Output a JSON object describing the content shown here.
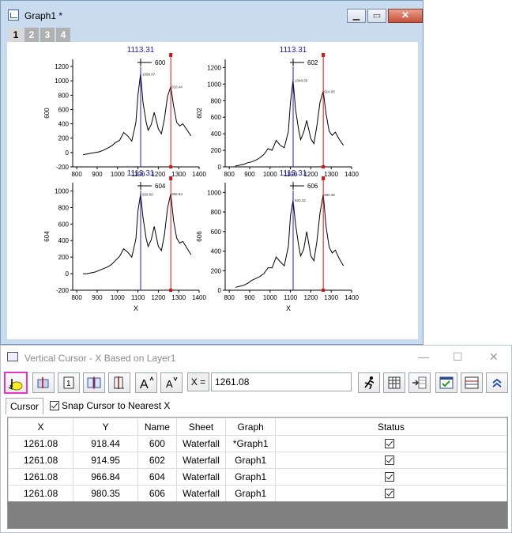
{
  "graph_window": {
    "title": "Graph1 *",
    "layer_tabs": [
      "1",
      "2",
      "3",
      "4"
    ],
    "active_layer": "1"
  },
  "chart_data": [
    {
      "type": "line",
      "layer": "600",
      "legend": "600",
      "ylabel": "600",
      "xlabel": "",
      "xlim": [
        780,
        1400
      ],
      "ylim": [
        -200,
        1300
      ],
      "xticks": [
        "800",
        "900",
        "1000",
        "1100",
        "1200",
        "1300",
        "1400"
      ],
      "yticks": [
        "-200",
        "0",
        "200",
        "400",
        "600",
        "800",
        "1000",
        "1200"
      ],
      "cursor_value": "1113.31",
      "blue_cursor_x": 1113.31,
      "red_cursor_x": 1261.08,
      "label_left": "1098.07",
      "label_right": "918.44",
      "peak_left_y": 1098.07,
      "peak_right_y": 918.44,
      "x": [
        830,
        850,
        870,
        890,
        910,
        930,
        950,
        970,
        990,
        1010,
        1030,
        1050,
        1070,
        1090,
        1100,
        1113,
        1125,
        1140,
        1150,
        1165,
        1180,
        1200,
        1215,
        1230,
        1245,
        1261,
        1275,
        1290,
        1305,
        1320,
        1340,
        1360
      ],
      "y": [
        -30,
        -20,
        -10,
        0,
        10,
        30,
        60,
        90,
        140,
        170,
        280,
        230,
        160,
        420,
        800,
        1098,
        700,
        430,
        310,
        390,
        560,
        330,
        260,
        470,
        780,
        918,
        650,
        420,
        370,
        400,
        320,
        230
      ]
    },
    {
      "type": "line",
      "layer": "602",
      "legend": "602",
      "ylabel": "602",
      "xlabel": "",
      "xlim": [
        780,
        1400
      ],
      "ylim": [
        0,
        1300
      ],
      "xticks": [
        "800",
        "900",
        "1000",
        "1100",
        "1200",
        "1300",
        "1400"
      ],
      "yticks": [
        "0",
        "200",
        "400",
        "600",
        "800",
        "1000",
        "1200"
      ],
      "cursor_value": "1113.31",
      "blue_cursor_x": 1113.31,
      "red_cursor_x": 1261.08,
      "label_left": "1048.55",
      "label_right": "914.95",
      "peak_left_y": 1048.55,
      "peak_right_y": 914.95,
      "x": [
        830,
        850,
        870,
        890,
        910,
        930,
        950,
        970,
        990,
        1010,
        1030,
        1050,
        1070,
        1090,
        1100,
        1113,
        1125,
        1140,
        1150,
        1165,
        1180,
        1200,
        1215,
        1230,
        1245,
        1261,
        1275,
        1290,
        1305,
        1320,
        1340,
        1360
      ],
      "y": [
        10,
        20,
        30,
        50,
        60,
        80,
        110,
        150,
        220,
        200,
        320,
        260,
        230,
        430,
        780,
        1048,
        700,
        450,
        330,
        420,
        560,
        340,
        280,
        500,
        780,
        915,
        640,
        430,
        380,
        420,
        330,
        260
      ]
    },
    {
      "type": "line",
      "layer": "604",
      "legend": "604",
      "ylabel": "604",
      "xlabel": "X",
      "xlim": [
        780,
        1400
      ],
      "ylim": [
        -200,
        1100
      ],
      "xticks": [
        "800",
        "900",
        "1000",
        "1100",
        "1200",
        "1300",
        "1400"
      ],
      "yticks": [
        "-200",
        "0",
        "200",
        "400",
        "600",
        "800",
        "1000"
      ],
      "cursor_value": "1113.31",
      "blue_cursor_x": 1113.31,
      "red_cursor_x": 1261.08,
      "label_left": "959.56",
      "label_right": "966.84",
      "peak_left_y": 959.56,
      "peak_right_y": 966.84,
      "x": [
        830,
        850,
        870,
        890,
        910,
        930,
        950,
        970,
        990,
        1010,
        1030,
        1050,
        1070,
        1090,
        1100,
        1113,
        1125,
        1140,
        1150,
        1165,
        1180,
        1200,
        1215,
        1230,
        1245,
        1261,
        1275,
        1290,
        1305,
        1320,
        1340,
        1360
      ],
      "y": [
        0,
        0,
        10,
        20,
        40,
        60,
        80,
        110,
        160,
        210,
        300,
        260,
        200,
        420,
        760,
        960,
        680,
        430,
        330,
        410,
        570,
        330,
        280,
        470,
        790,
        967,
        640,
        430,
        370,
        390,
        310,
        230
      ]
    },
    {
      "type": "line",
      "layer": "606",
      "legend": "606",
      "ylabel": "606",
      "xlabel": "X",
      "xlim": [
        780,
        1400
      ],
      "ylim": [
        0,
        1100
      ],
      "xticks": [
        "800",
        "900",
        "1000",
        "1100",
        "1200",
        "1300",
        "1400"
      ],
      "yticks": [
        "0",
        "200",
        "400",
        "600",
        "800",
        "1000"
      ],
      "cursor_value": "1113.31",
      "blue_cursor_x": 1113.31,
      "red_cursor_x": 1261.08,
      "label_left": "920.32",
      "label_right": "980.35",
      "peak_left_y": 920.32,
      "peak_right_y": 980.35,
      "x": [
        830,
        850,
        870,
        890,
        910,
        930,
        950,
        970,
        990,
        1010,
        1030,
        1050,
        1070,
        1090,
        1100,
        1113,
        1125,
        1140,
        1150,
        1165,
        1180,
        1200,
        1215,
        1230,
        1245,
        1261,
        1275,
        1290,
        1305,
        1320,
        1340,
        1360
      ],
      "y": [
        30,
        40,
        50,
        70,
        100,
        120,
        140,
        170,
        230,
        230,
        340,
        290,
        250,
        450,
        760,
        920,
        680,
        460,
        350,
        420,
        600,
        350,
        300,
        500,
        790,
        980,
        650,
        440,
        380,
        410,
        320,
        250
      ]
    }
  ],
  "cursor_window": {
    "title": "Vertical Cursor - X Based on Layer1",
    "x_label": "X =",
    "x_value": "1261.08",
    "tab_label": "Cursor",
    "snap_label": "Snap Cursor to Nearest X",
    "snap_checked": true,
    "toolbar_icons": [
      "select-cursor-icon",
      "add-cursor-icon",
      "one-cursor-icon",
      "two-cursor-icon",
      "edit-labels-icon",
      "increase-font-icon",
      "decrease-font-icon",
      "run-icon",
      "table-icon",
      "export-icon",
      "report-icon",
      "settings-icon",
      "collapse-icon"
    ],
    "columns": [
      "X",
      "Y",
      "Name",
      "Sheet",
      "Graph",
      "Status"
    ],
    "rows": [
      {
        "x": "1261.08",
        "y": "918.44",
        "name": "600",
        "sheet": "Waterfall",
        "graph": "*Graph1",
        "status": true
      },
      {
        "x": "1261.08",
        "y": "914.95",
        "name": "602",
        "sheet": "Waterfall",
        "graph": "Graph1",
        "status": true
      },
      {
        "x": "1261.08",
        "y": "966.84",
        "name": "604",
        "sheet": "Waterfall",
        "graph": "Graph1",
        "status": true
      },
      {
        "x": "1261.08",
        "y": "980.35",
        "name": "606",
        "sheet": "Waterfall",
        "graph": "Graph1",
        "status": true
      }
    ]
  },
  "colors": {
    "blue_cursor": "#1a1ae0",
    "red_cursor": "#dd1111",
    "label_blue": "#1a1ad0",
    "highlight": "#e834c9"
  }
}
